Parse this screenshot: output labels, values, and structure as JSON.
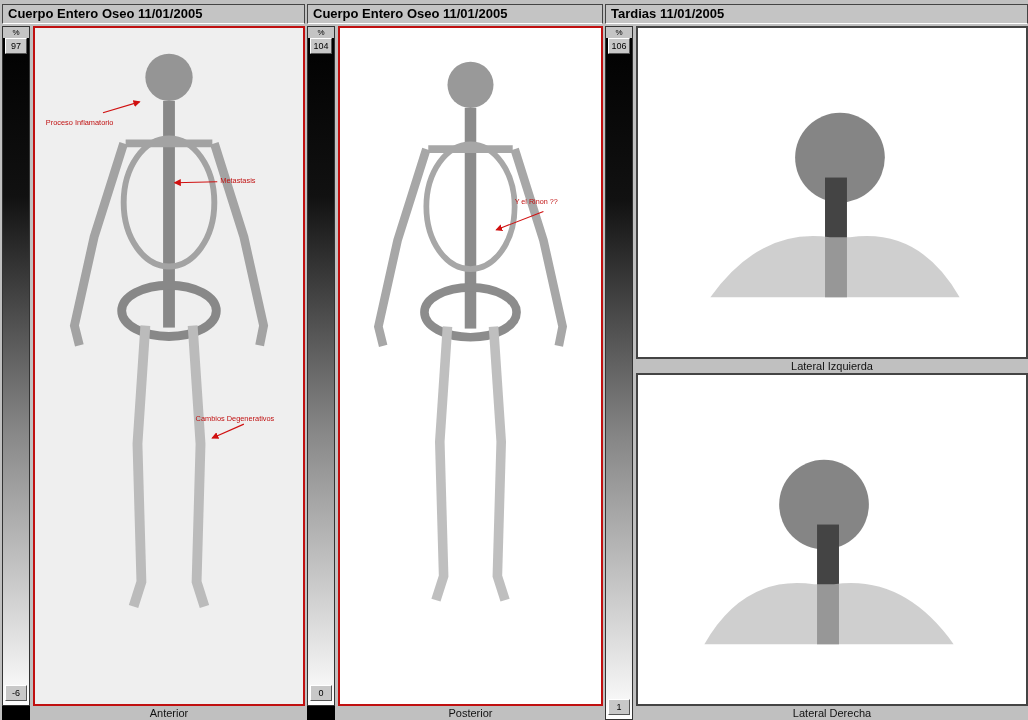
{
  "panels": [
    {
      "title": "Cuerpo Entero Oseo 11/01/2005",
      "scale": {
        "unit": "%",
        "max": "97",
        "min": "-6"
      },
      "views": [
        {
          "kind": "whole-body",
          "caption": "Anterior",
          "selected": true,
          "annotations": [
            {
              "text": "Proceso Inflamatorio"
            },
            {
              "text": "Metastasis"
            },
            {
              "text": "Cambios Degenerativos"
            }
          ]
        }
      ]
    },
    {
      "title": "Cuerpo Entero Oseo 11/01/2005",
      "scale": {
        "unit": "%",
        "max": "104",
        "min": "0"
      },
      "views": [
        {
          "kind": "whole-body",
          "caption": "Posterior",
          "selected": true,
          "annotations": [
            {
              "text": "Y el Rinon ??"
            }
          ]
        }
      ]
    },
    {
      "title": "Tardias 11/01/2005",
      "scale": {
        "unit": "%",
        "max": "106",
        "min": "1"
      },
      "views": [
        {
          "kind": "lateral-left",
          "caption": "Lateral Izquierda",
          "selected": false
        },
        {
          "kind": "lateral-right",
          "caption": "Lateral Derecha",
          "selected": false
        }
      ]
    }
  ]
}
